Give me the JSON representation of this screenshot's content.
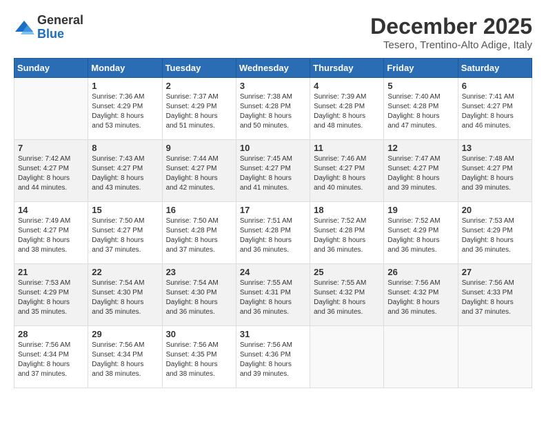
{
  "header": {
    "logo_line1": "General",
    "logo_line2": "Blue",
    "title": "December 2025",
    "subtitle": "Tesero, Trentino-Alto Adige, Italy"
  },
  "days_of_week": [
    "Sunday",
    "Monday",
    "Tuesday",
    "Wednesday",
    "Thursday",
    "Friday",
    "Saturday"
  ],
  "weeks": [
    [
      {
        "day": "",
        "info": ""
      },
      {
        "day": "1",
        "info": "Sunrise: 7:36 AM\nSunset: 4:29 PM\nDaylight: 8 hours\nand 53 minutes."
      },
      {
        "day": "2",
        "info": "Sunrise: 7:37 AM\nSunset: 4:29 PM\nDaylight: 8 hours\nand 51 minutes."
      },
      {
        "day": "3",
        "info": "Sunrise: 7:38 AM\nSunset: 4:28 PM\nDaylight: 8 hours\nand 50 minutes."
      },
      {
        "day": "4",
        "info": "Sunrise: 7:39 AM\nSunset: 4:28 PM\nDaylight: 8 hours\nand 48 minutes."
      },
      {
        "day": "5",
        "info": "Sunrise: 7:40 AM\nSunset: 4:28 PM\nDaylight: 8 hours\nand 47 minutes."
      },
      {
        "day": "6",
        "info": "Sunrise: 7:41 AM\nSunset: 4:27 PM\nDaylight: 8 hours\nand 46 minutes."
      }
    ],
    [
      {
        "day": "7",
        "info": "Sunrise: 7:42 AM\nSunset: 4:27 PM\nDaylight: 8 hours\nand 44 minutes."
      },
      {
        "day": "8",
        "info": "Sunrise: 7:43 AM\nSunset: 4:27 PM\nDaylight: 8 hours\nand 43 minutes."
      },
      {
        "day": "9",
        "info": "Sunrise: 7:44 AM\nSunset: 4:27 PM\nDaylight: 8 hours\nand 42 minutes."
      },
      {
        "day": "10",
        "info": "Sunrise: 7:45 AM\nSunset: 4:27 PM\nDaylight: 8 hours\nand 41 minutes."
      },
      {
        "day": "11",
        "info": "Sunrise: 7:46 AM\nSunset: 4:27 PM\nDaylight: 8 hours\nand 40 minutes."
      },
      {
        "day": "12",
        "info": "Sunrise: 7:47 AM\nSunset: 4:27 PM\nDaylight: 8 hours\nand 39 minutes."
      },
      {
        "day": "13",
        "info": "Sunrise: 7:48 AM\nSunset: 4:27 PM\nDaylight: 8 hours\nand 39 minutes."
      }
    ],
    [
      {
        "day": "14",
        "info": "Sunrise: 7:49 AM\nSunset: 4:27 PM\nDaylight: 8 hours\nand 38 minutes."
      },
      {
        "day": "15",
        "info": "Sunrise: 7:50 AM\nSunset: 4:27 PM\nDaylight: 8 hours\nand 37 minutes."
      },
      {
        "day": "16",
        "info": "Sunrise: 7:50 AM\nSunset: 4:28 PM\nDaylight: 8 hours\nand 37 minutes."
      },
      {
        "day": "17",
        "info": "Sunrise: 7:51 AM\nSunset: 4:28 PM\nDaylight: 8 hours\nand 36 minutes."
      },
      {
        "day": "18",
        "info": "Sunrise: 7:52 AM\nSunset: 4:28 PM\nDaylight: 8 hours\nand 36 minutes."
      },
      {
        "day": "19",
        "info": "Sunrise: 7:52 AM\nSunset: 4:29 PM\nDaylight: 8 hours\nand 36 minutes."
      },
      {
        "day": "20",
        "info": "Sunrise: 7:53 AM\nSunset: 4:29 PM\nDaylight: 8 hours\nand 36 minutes."
      }
    ],
    [
      {
        "day": "21",
        "info": "Sunrise: 7:53 AM\nSunset: 4:29 PM\nDaylight: 8 hours\nand 35 minutes."
      },
      {
        "day": "22",
        "info": "Sunrise: 7:54 AM\nSunset: 4:30 PM\nDaylight: 8 hours\nand 35 minutes."
      },
      {
        "day": "23",
        "info": "Sunrise: 7:54 AM\nSunset: 4:30 PM\nDaylight: 8 hours\nand 36 minutes."
      },
      {
        "day": "24",
        "info": "Sunrise: 7:55 AM\nSunset: 4:31 PM\nDaylight: 8 hours\nand 36 minutes."
      },
      {
        "day": "25",
        "info": "Sunrise: 7:55 AM\nSunset: 4:32 PM\nDaylight: 8 hours\nand 36 minutes."
      },
      {
        "day": "26",
        "info": "Sunrise: 7:56 AM\nSunset: 4:32 PM\nDaylight: 8 hours\nand 36 minutes."
      },
      {
        "day": "27",
        "info": "Sunrise: 7:56 AM\nSunset: 4:33 PM\nDaylight: 8 hours\nand 37 minutes."
      }
    ],
    [
      {
        "day": "28",
        "info": "Sunrise: 7:56 AM\nSunset: 4:34 PM\nDaylight: 8 hours\nand 37 minutes."
      },
      {
        "day": "29",
        "info": "Sunrise: 7:56 AM\nSunset: 4:34 PM\nDaylight: 8 hours\nand 38 minutes."
      },
      {
        "day": "30",
        "info": "Sunrise: 7:56 AM\nSunset: 4:35 PM\nDaylight: 8 hours\nand 38 minutes."
      },
      {
        "day": "31",
        "info": "Sunrise: 7:56 AM\nSunset: 4:36 PM\nDaylight: 8 hours\nand 39 minutes."
      },
      {
        "day": "",
        "info": ""
      },
      {
        "day": "",
        "info": ""
      },
      {
        "day": "",
        "info": ""
      }
    ]
  ]
}
